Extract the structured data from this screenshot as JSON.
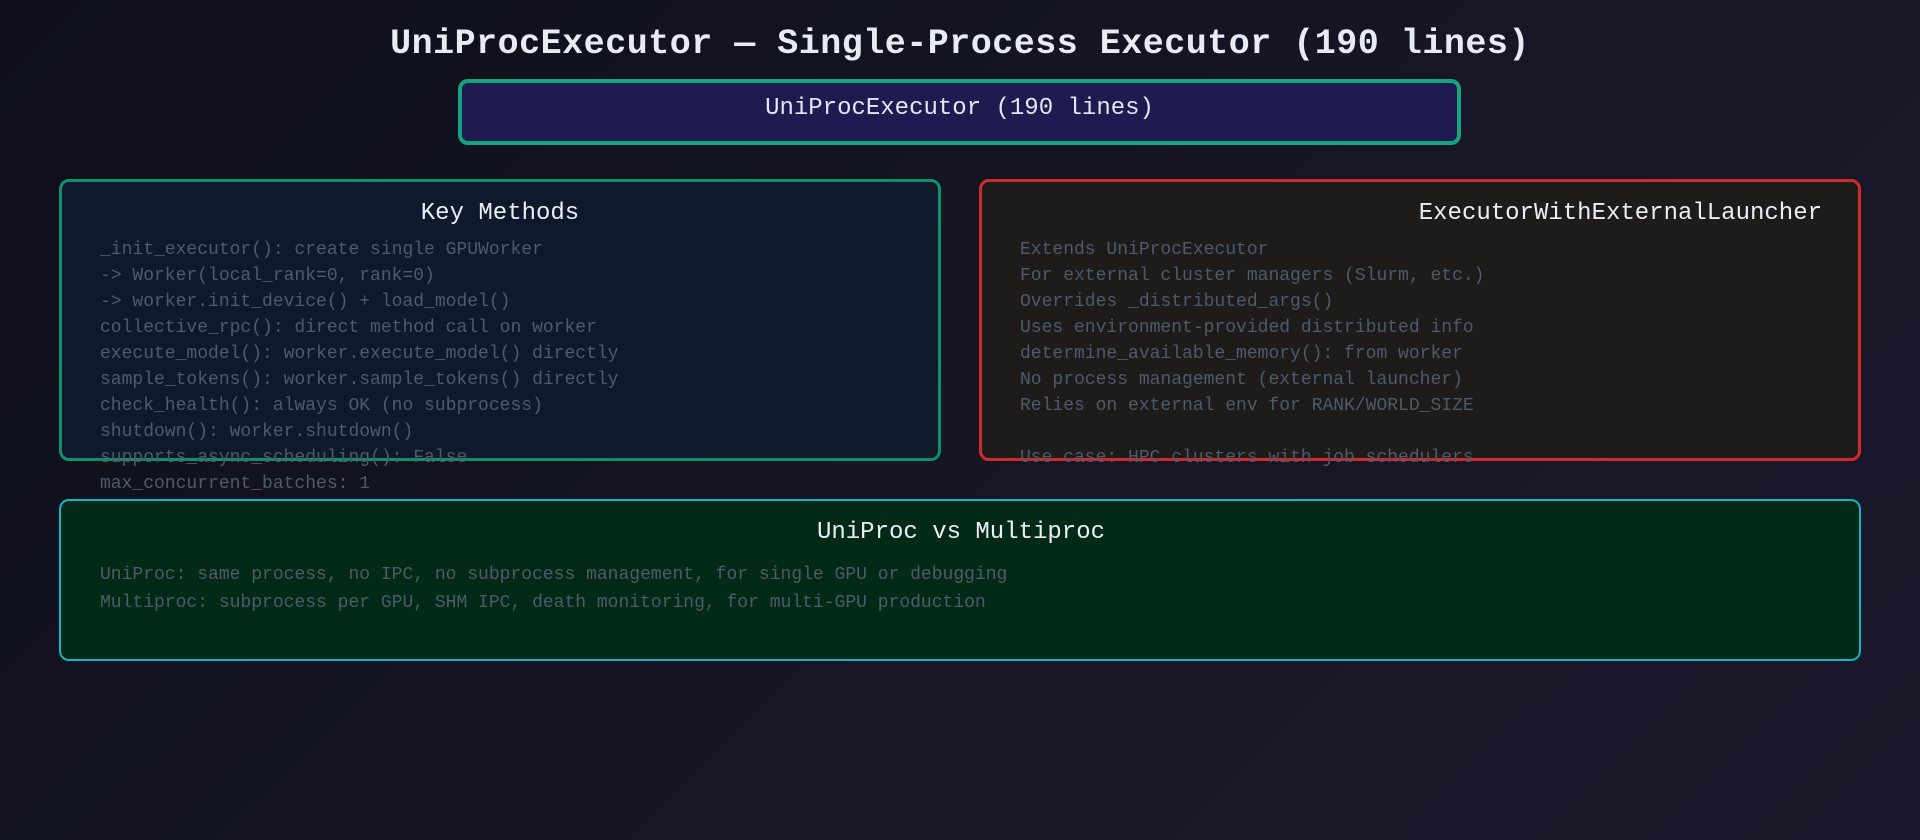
{
  "title": "UniProcExecutor — Single-Process Executor (190 lines)",
  "header_box": {
    "label": "UniProcExecutor (190 lines)"
  },
  "key_methods": {
    "title": "Key Methods",
    "lines": [
      "_init_executor(): create single GPUWorker",
      "-> Worker(local_rank=0, rank=0)",
      "-> worker.init_device() + load_model()",
      "collective_rpc(): direct method call on worker",
      "execute_model(): worker.execute_model() directly",
      "sample_tokens(): worker.sample_tokens() directly",
      "check_health(): always OK (no subprocess)",
      "shutdown(): worker.shutdown()",
      "supports_async_scheduling(): False",
      "max_concurrent_batches: 1"
    ]
  },
  "external_launcher": {
    "title": "ExecutorWithExternalLauncher",
    "lines": [
      "Extends UniProcExecutor",
      "For external cluster managers (Slurm, etc.)",
      "Overrides _distributed_args()",
      "Uses environment-provided distributed info",
      "determine_available_memory(): from worker",
      "No process management (external launcher)",
      "Relies on external env for RANK/WORLD_SIZE"
    ],
    "use_case": "Use case: HPC clusters with job schedulers"
  },
  "comparison": {
    "title": "UniProc vs Multiproc",
    "lines": [
      "UniProc: same process, no IPC, no subprocess management, for single GPU or debugging",
      "Multiproc: subprocess per GPU, SHM IPC, death monitoring, for multi-GPU production"
    ]
  },
  "colors": {
    "header_border": "#16a37f",
    "header_fill": "#1f1a4f",
    "methods_border": "#0f8f6c",
    "methods_fill": "#0e1a2c",
    "launcher_border": "#d02a2a",
    "launcher_fill": "#1e1b1b",
    "compare_border": "#12b3c4",
    "compare_fill": "#032a17",
    "body_text": "#4f5a6a"
  }
}
